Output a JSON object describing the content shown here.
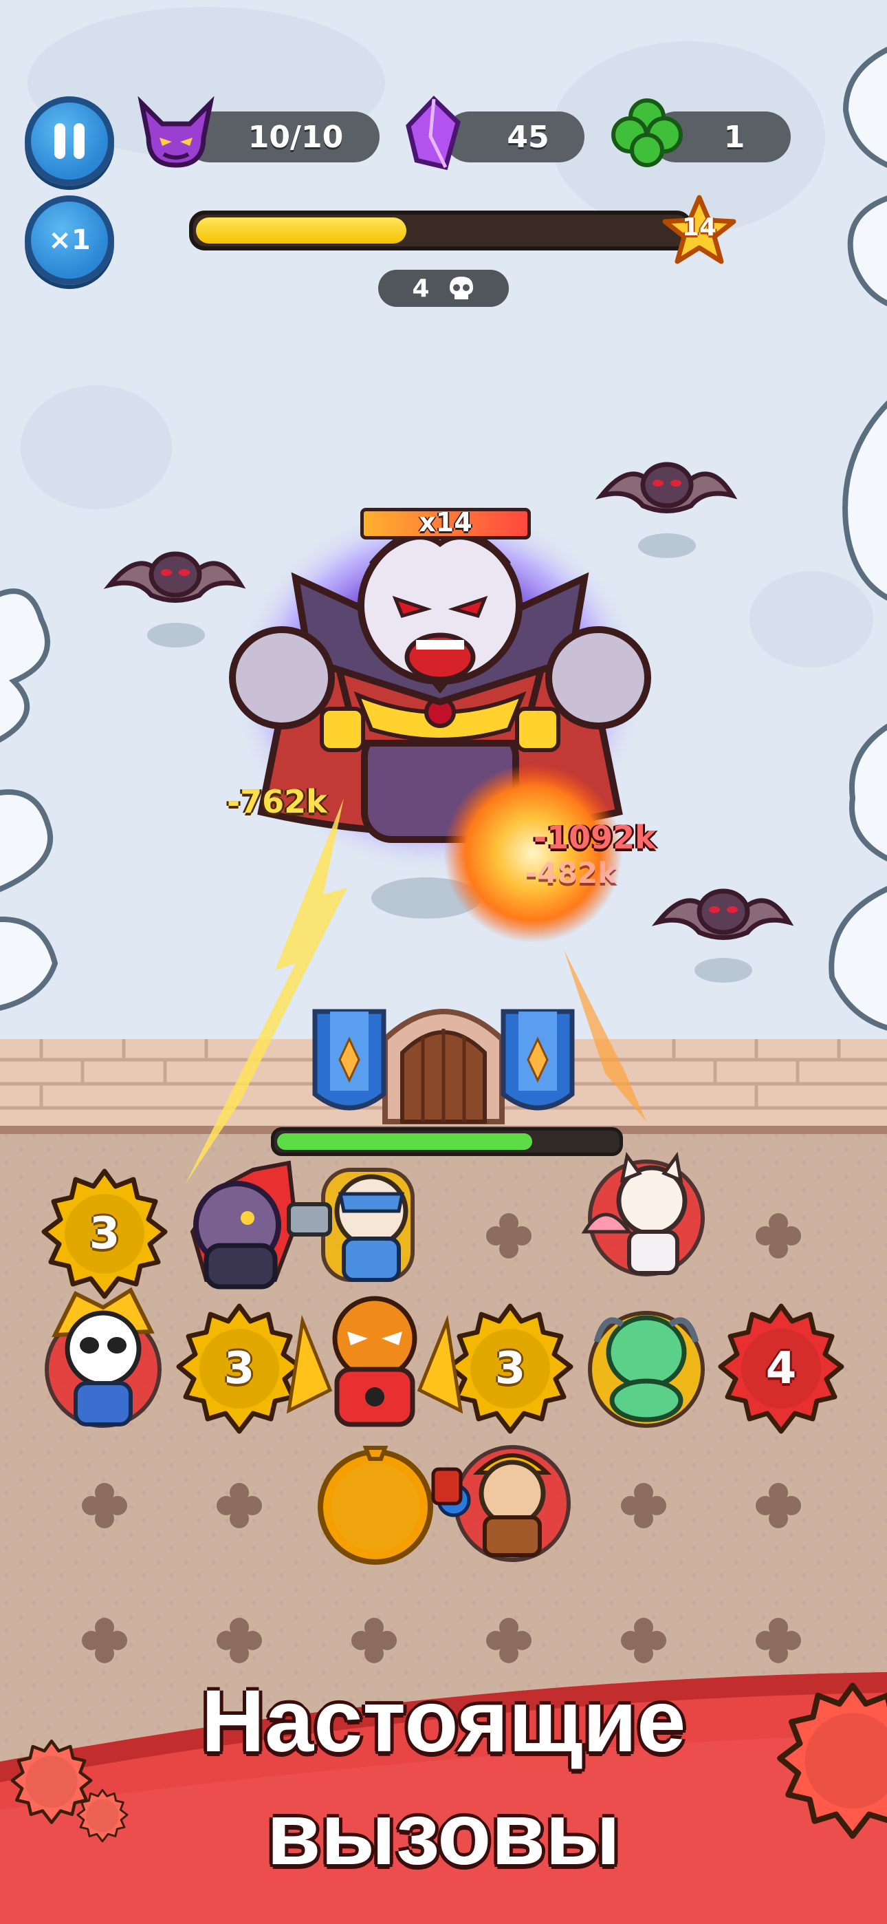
{
  "hud": {
    "pause_icon": "pause-icon",
    "speed_label": "×1",
    "demons_value": "10/10",
    "crystals_value": "45",
    "clover_value": "1",
    "wave_progress": 0.43,
    "level": "14",
    "kills": "4"
  },
  "boss": {
    "multiplier": "x14",
    "hp_fraction": 1.0
  },
  "damage_numbers": [
    "-762k",
    "-1092k",
    "-482k"
  ],
  "castle": {
    "hp_fraction": 0.75
  },
  "board": {
    "gear_levels": [
      "3",
      "3",
      "3",
      "4"
    ]
  },
  "banner": {
    "line1": "Настоящие",
    "line2": "вызовы"
  },
  "colors": {
    "sky": "#dfe8f3",
    "wall": "#e8c9b6",
    "ground": "#cdb2a0",
    "banner": "#e84545",
    "gold_gear": "#f5b800",
    "red_gear": "#e83030"
  },
  "icons": [
    "pause-icon",
    "demon-icon",
    "crystal-icon",
    "clover-icon",
    "star-icon",
    "skull-icon",
    "gear-icon",
    "bat-icon"
  ]
}
